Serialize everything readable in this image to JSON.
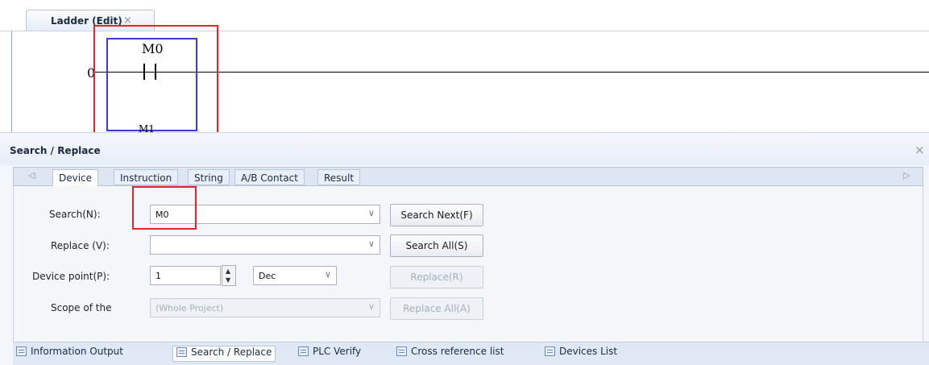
{
  "document_tab": {
    "label": "Ladder (Edit)",
    "close": "×"
  },
  "ladder": {
    "step": "0",
    "contact_device": "M0",
    "next_device": "M1"
  },
  "panel": {
    "title": "Search / Replace",
    "close": "×",
    "nav_left": "◁",
    "nav_right": "▷",
    "tabs": [
      "Device",
      "Instruction",
      "String",
      "A/B Contact",
      "Result"
    ],
    "search_label": "Search(N):",
    "search_value": "M0",
    "replace_label": "Replace (V):",
    "replace_value": "",
    "device_point_label": "Device point(P):",
    "device_point_value": "1",
    "radix_value": "Dec",
    "scope_label": "Scope of the",
    "scope_value": "(Whole Project)",
    "buttons": {
      "search_next": "Search Next(F)",
      "search_all": "Search All(S)",
      "replace": "Replace(R)",
      "replace_all": "Replace All(A)"
    },
    "dropdown_arrow": "∨"
  },
  "bottom_tabs": [
    "Information Output",
    "Search / Replace",
    "PLC Verify",
    "Cross reference list",
    "Devices List"
  ],
  "colors": {
    "highlight": "#e0262b",
    "cell_border": "#3a3ad8",
    "panel_bg": "#f2f5fa"
  }
}
